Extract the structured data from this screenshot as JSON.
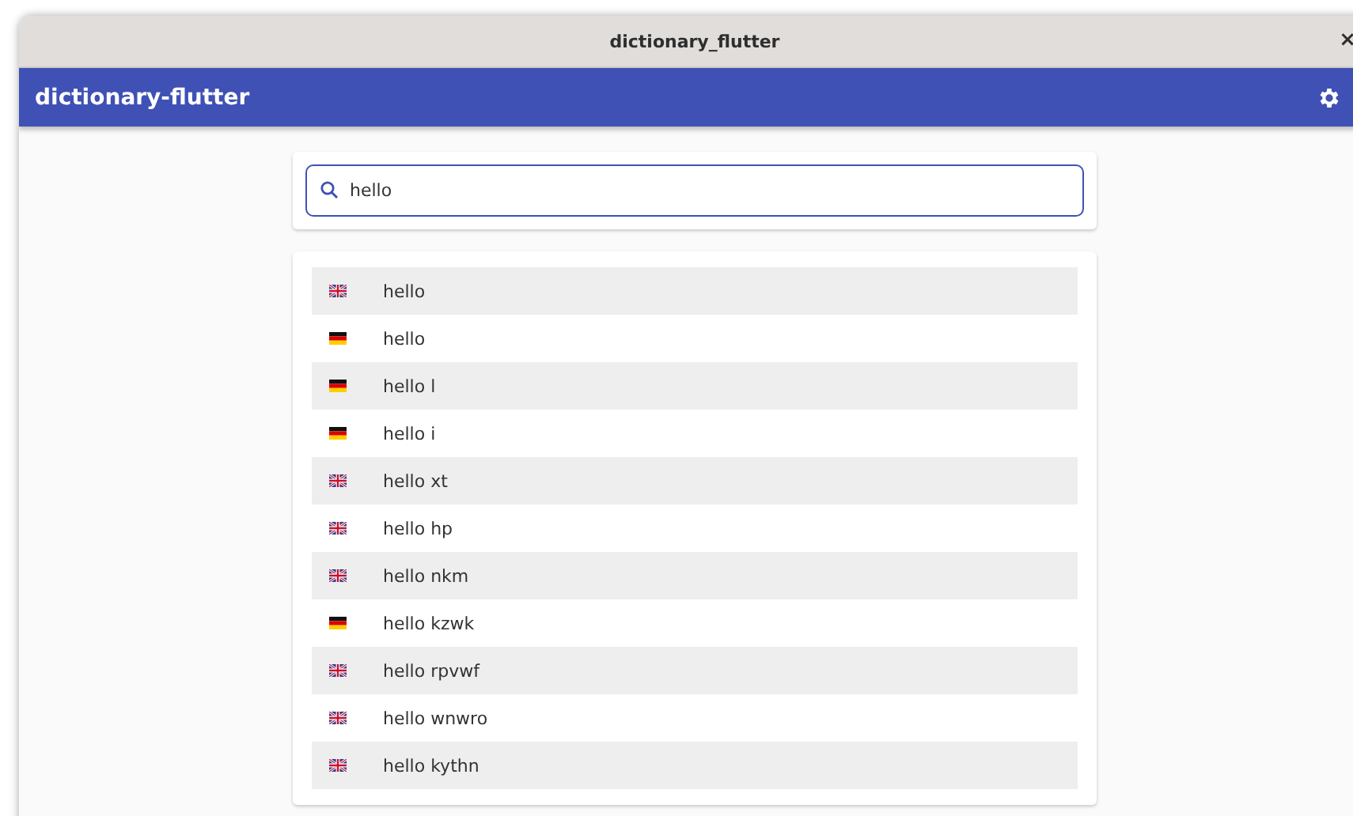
{
  "window": {
    "title": "dictionary_flutter",
    "close": "×"
  },
  "app_bar": {
    "title": "dictionary-flutter"
  },
  "search": {
    "value": "hello"
  },
  "results": [
    {
      "kind": "en",
      "word": "hello"
    },
    {
      "kind": "de",
      "word": "hello"
    },
    {
      "kind": "de",
      "word": "hello l"
    },
    {
      "kind": "de",
      "word": "hello i"
    },
    {
      "kind": "en",
      "word": "hello xt"
    },
    {
      "kind": "en",
      "word": "hello hp"
    },
    {
      "kind": "en",
      "word": "hello nkm"
    },
    {
      "kind": "de",
      "word": "hello kzwk"
    },
    {
      "kind": "en",
      "word": "hello rpvwf"
    },
    {
      "kind": "en",
      "word": "hello wnwro"
    },
    {
      "kind": "en",
      "word": "hello kythn"
    }
  ]
}
